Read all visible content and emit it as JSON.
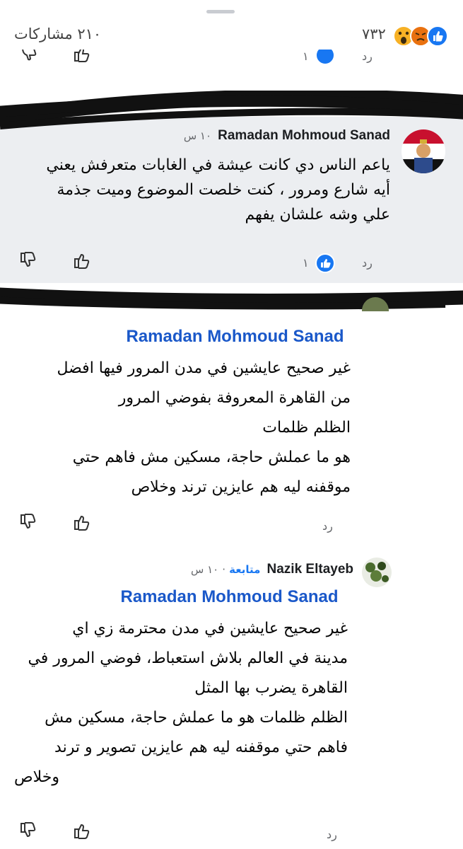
{
  "header": {
    "shares": "٢١٠ مشاركات",
    "reaction_count": "٧٣٢",
    "reaction_icons": [
      "like-icon",
      "angry-icon",
      "wow-icon"
    ]
  },
  "faded_row": {
    "reply": "رد",
    "like_count": "١"
  },
  "comments": [
    {
      "author": "Ramadan Mohmoud Sanad",
      "time": "١٠ س",
      "lines": [
        "ياعم الناس دي كانت عيشة في الغابات متعرفش يعني",
        "أيه شارع ومرور ، كنت خلصت الموضوع وميت جذمة",
        "علي وشه علشان يفهم"
      ],
      "like_count": "١",
      "reply": "رد"
    },
    {
      "mention": "Ramadan Mohmoud Sanad",
      "lines": [
        "غير صحيح عايشين في مدن المرور فيها افضل",
        "من القاهرة المعروفة بفوضي المرور",
        "الظلم ظلمات",
        "هو ما عملش حاجة، مسكين مش فاهم حتي",
        "موقفنه ليه هم عايزين ترند  وخلاص"
      ],
      "reply": "رد"
    },
    {
      "author": "Nazik Eltayeb",
      "time": "١٠ س",
      "separator": "·",
      "follow": "متابعة",
      "mention": "Ramadan Mohmoud Sanad",
      "lines": [
        "غير صحيح  عايشين في مدن محترمة زي اي",
        "مدينة في العالم بلاش استعباط، فوضي المرور في",
        "القاهرة  يضرب بها المثل",
        "الظلم ظلمات هو ما عملش حاجة، مسكين مش",
        "فاهم حتي موقفنه ليه هم عايزين تصوير و ترند",
        "وخلاص"
      ],
      "reply": "رد"
    }
  ],
  "colors": {
    "accent": "#1877f2",
    "mention": "#1a58c9",
    "highlight_bg": "#eceef1",
    "scribble": "#111111"
  }
}
